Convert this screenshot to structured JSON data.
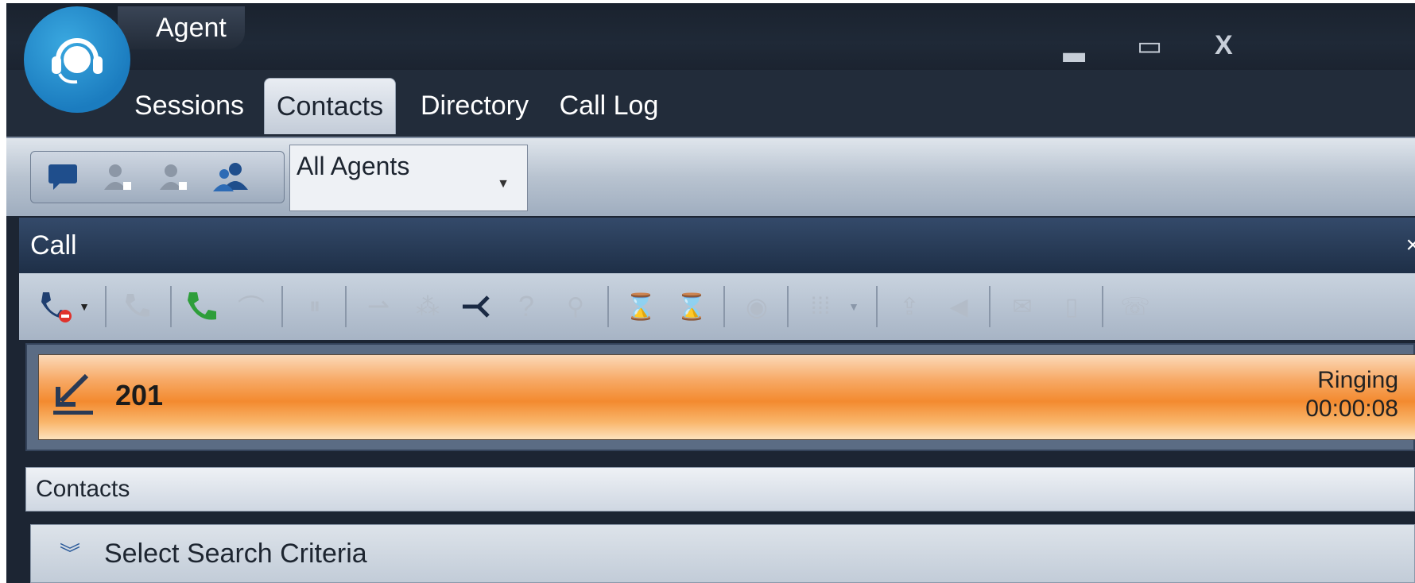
{
  "window": {
    "title": "Agent",
    "controls": {
      "minimize": "▂",
      "maximize": "▭",
      "close": "X"
    }
  },
  "tabs": [
    {
      "label": "Sessions",
      "active": false
    },
    {
      "label": "Contacts",
      "active": true
    },
    {
      "label": "Directory",
      "active": false
    },
    {
      "label": "Call Log",
      "active": false
    }
  ],
  "toolbar": {
    "icons": [
      "chat-icon",
      "add-contact-icon",
      "remove-contact-icon",
      "group-icon"
    ],
    "filter_value": "All Agents"
  },
  "call_panel": {
    "title": "Call",
    "close": "×",
    "number": "201",
    "status": "Ringing",
    "duration": "00:00:08",
    "bar_color": "#f38a2f"
  },
  "contacts_section": {
    "title": "Contacts",
    "search_criteria_label": "Select Search Criteria",
    "expand_glyph": "»"
  }
}
